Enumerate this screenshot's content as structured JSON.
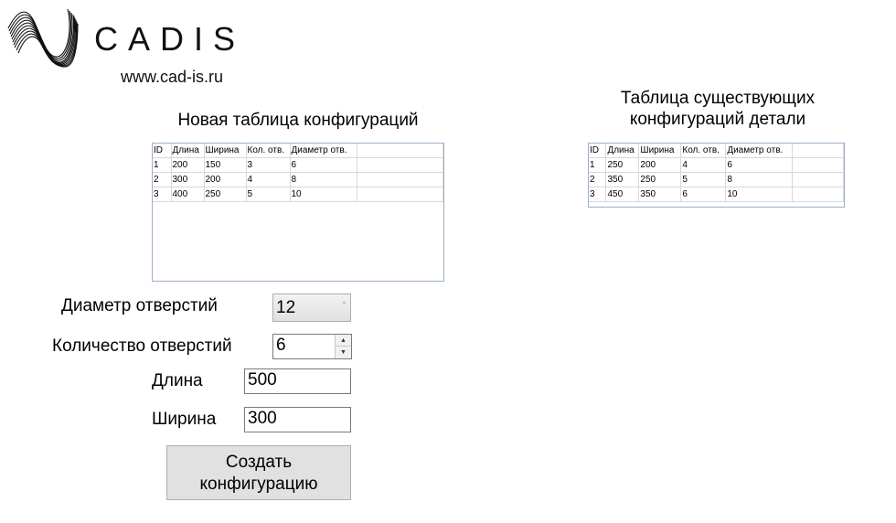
{
  "logo": {
    "name": "CADIS",
    "url": "www.cad-is.ru"
  },
  "new_table": {
    "caption": "Новая таблица конфигураций",
    "columns": [
      "ID",
      "Длина",
      "Ширина",
      "Кол. отв.",
      "Диаметр отв."
    ],
    "rows": [
      [
        "1",
        "200",
        "150",
        "3",
        "6"
      ],
      [
        "2",
        "300",
        "200",
        "4",
        "8"
      ],
      [
        "3",
        "400",
        "250",
        "5",
        "10"
      ]
    ]
  },
  "existing_table": {
    "caption": "Таблица существующих конфигураций детали",
    "columns": [
      "ID",
      "Длина",
      "Ширина",
      "Кол. отв.",
      "Диаметр отв."
    ],
    "rows": [
      [
        "1",
        "250",
        "200",
        "4",
        "6"
      ],
      [
        "2",
        "350",
        "250",
        "5",
        "8"
      ],
      [
        "3",
        "450",
        "350",
        "6",
        "10"
      ]
    ]
  },
  "form": {
    "diameter_label": "Диаметр отверстий",
    "diameter_value": "12",
    "count_label": "Количество отверстий",
    "count_value": "6",
    "length_label": "Длина",
    "length_value": "500",
    "width_label": "Ширина",
    "width_value": "300",
    "create_button": "Создать конфигурацию"
  }
}
